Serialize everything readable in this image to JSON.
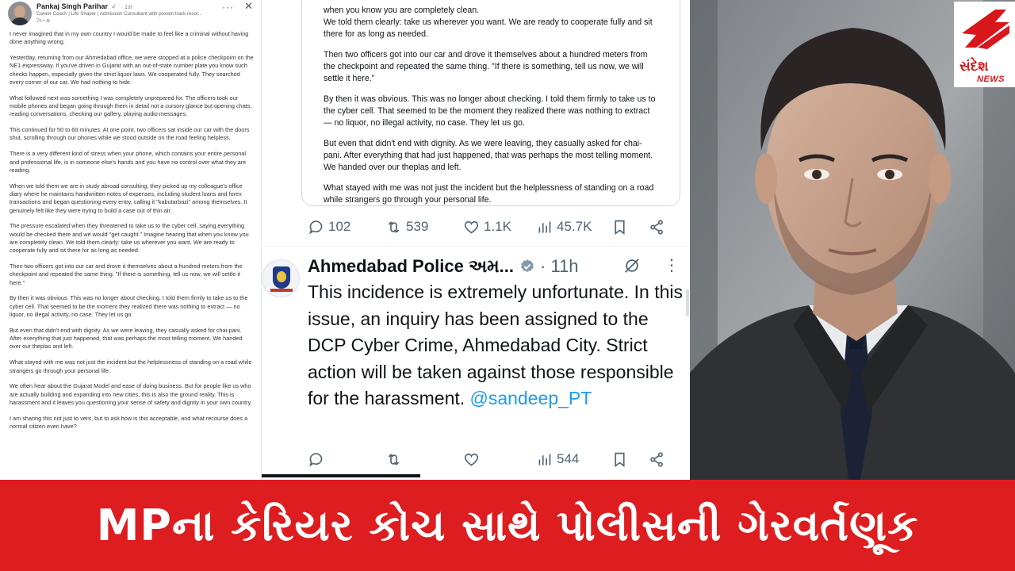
{
  "linkedin": {
    "author": "Pankaj Singh Parihar",
    "verified": "✓",
    "degree": "· 1st",
    "headline": "Career Coach | Life Shaper | Admission Consultant with proven track recor...",
    "time": "7h •",
    "paragraphs": [
      "I never imagined that in my own country I would be made to feel like a criminal without having done anything wrong.",
      "Yesterday, returning from our Ahmedabad office, we were stopped at a police checkpoint on the NE1 expressway. If you've driven in Gujarat with an out-of-state number plate you know such checks happen, especially given the strict liquor laws. We cooperated fully. They searched every corner of our car. We had nothing to hide.",
      "What followed next was something I was completely unprepared for. The officers took our mobile phones and began going through them in detail not a cursory glance but opening chats, reading conversations, checking our gallery, playing audio messages.",
      "This continued for 50 to 60 minutes. At one point, two officers sat inside our car with the doors shut, scrolling through our phones while we stood outside on the road feeling helpless.",
      "There is a very different kind of stress when your phone, which contains your entire personal and professional life, is in someone else's hands and you have no control over what they are reading.",
      "When we told them we are in study abroad consulting, they picked up my colleague's office diary where he maintains handwritten notes of expenses, including student loans and forex transactions and began questioning every entry, calling it \"kabutarbazi\" among themselves. It genuinely felt like they were trying to build a case out of thin air.",
      "The pressure escalated when they threatened to take us to the cyber cell, saying everything would be checked there and we would \"get caught.\" Imagine hearing that when you know you are completely clean. We told them clearly: take us wherever you want. We are ready to cooperate fully and sit there for as long as needed.",
      "Then two officers got into our car and drove it themselves about a hundred meters from the checkpoint and repeated the same thing. \"If there is something, tell us now, we will settle it here.\"",
      "By then it was obvious. This was no longer about checking. I told them firmly to take us to the cyber cell. That seemed to be the moment they realized there was nothing to extract — no liquor, no illegal activity, no case. They let us go.",
      "But even that didn't end with dignity. As we were leaving, they casually asked for chai-pani. After everything that just happened, that was perhaps the most telling moment. We handed over our theplas and left.",
      "What stayed with me was not just the incident but the helplessness of standing on a road while strangers go through your personal life.",
      "We often hear about the Gujarat Model and ease of doing business. But for people like us who are actually building and expanding into new cities, this is also the ground reality. This is harassment and it leaves you questioning your sense of safety and dignity in your own country.",
      "I am sharing this not just to vent, but to ask how is this acceptable, and what recourse does a normal citizen even have?"
    ]
  },
  "quoted_post": {
    "paragraphs": [
      "when you know you are completely clean.\nWe told them clearly: take us wherever you want. We are ready to cooperate fully and sit there for as long as needed.",
      "Then two officers got into our car and drove it themselves about a hundred meters from the checkpoint and repeated the same thing. \"If there is something, tell us now, we will settle it here.\"",
      "By then it was obvious. This was no longer about checking. I told them firmly to take us to the cyber cell. That seemed to be the moment they realized there was nothing to extract — no liquor, no illegal activity, no case. They let us go.",
      "But even that didn't end with dignity. As we were leaving, they casually asked for chai-pani. After everything that had just happened, that was perhaps the most telling moment. We handed over our theplas and left.",
      "What stayed with me was not just the incident but the helplessness of standing on a road while strangers go through your personal life."
    ],
    "stats": {
      "replies": "102",
      "reposts": "539",
      "likes": "1.1K",
      "views": "45.7K"
    }
  },
  "police_reply": {
    "name": "Ahmedabad Police અમ...",
    "time": "· 11h",
    "text": "This incidence is extremely unfortunate. In this issue, an inquiry has been assigned to the DCP Cyber Crime, Ahmedabad City. Strict action will be taken against those responsible for the harassment.",
    "mention": "@sandeep_PT",
    "stats": {
      "views": "544"
    }
  },
  "logo": {
    "name": "સંદેશ",
    "sub": "NEWS",
    "color": "#d8161c"
  },
  "banner": {
    "headline": "MPના કેરિયર કોચ સાથે પોલીસની ગેરવર્તણૂક",
    "color": "#dd1d1f"
  }
}
